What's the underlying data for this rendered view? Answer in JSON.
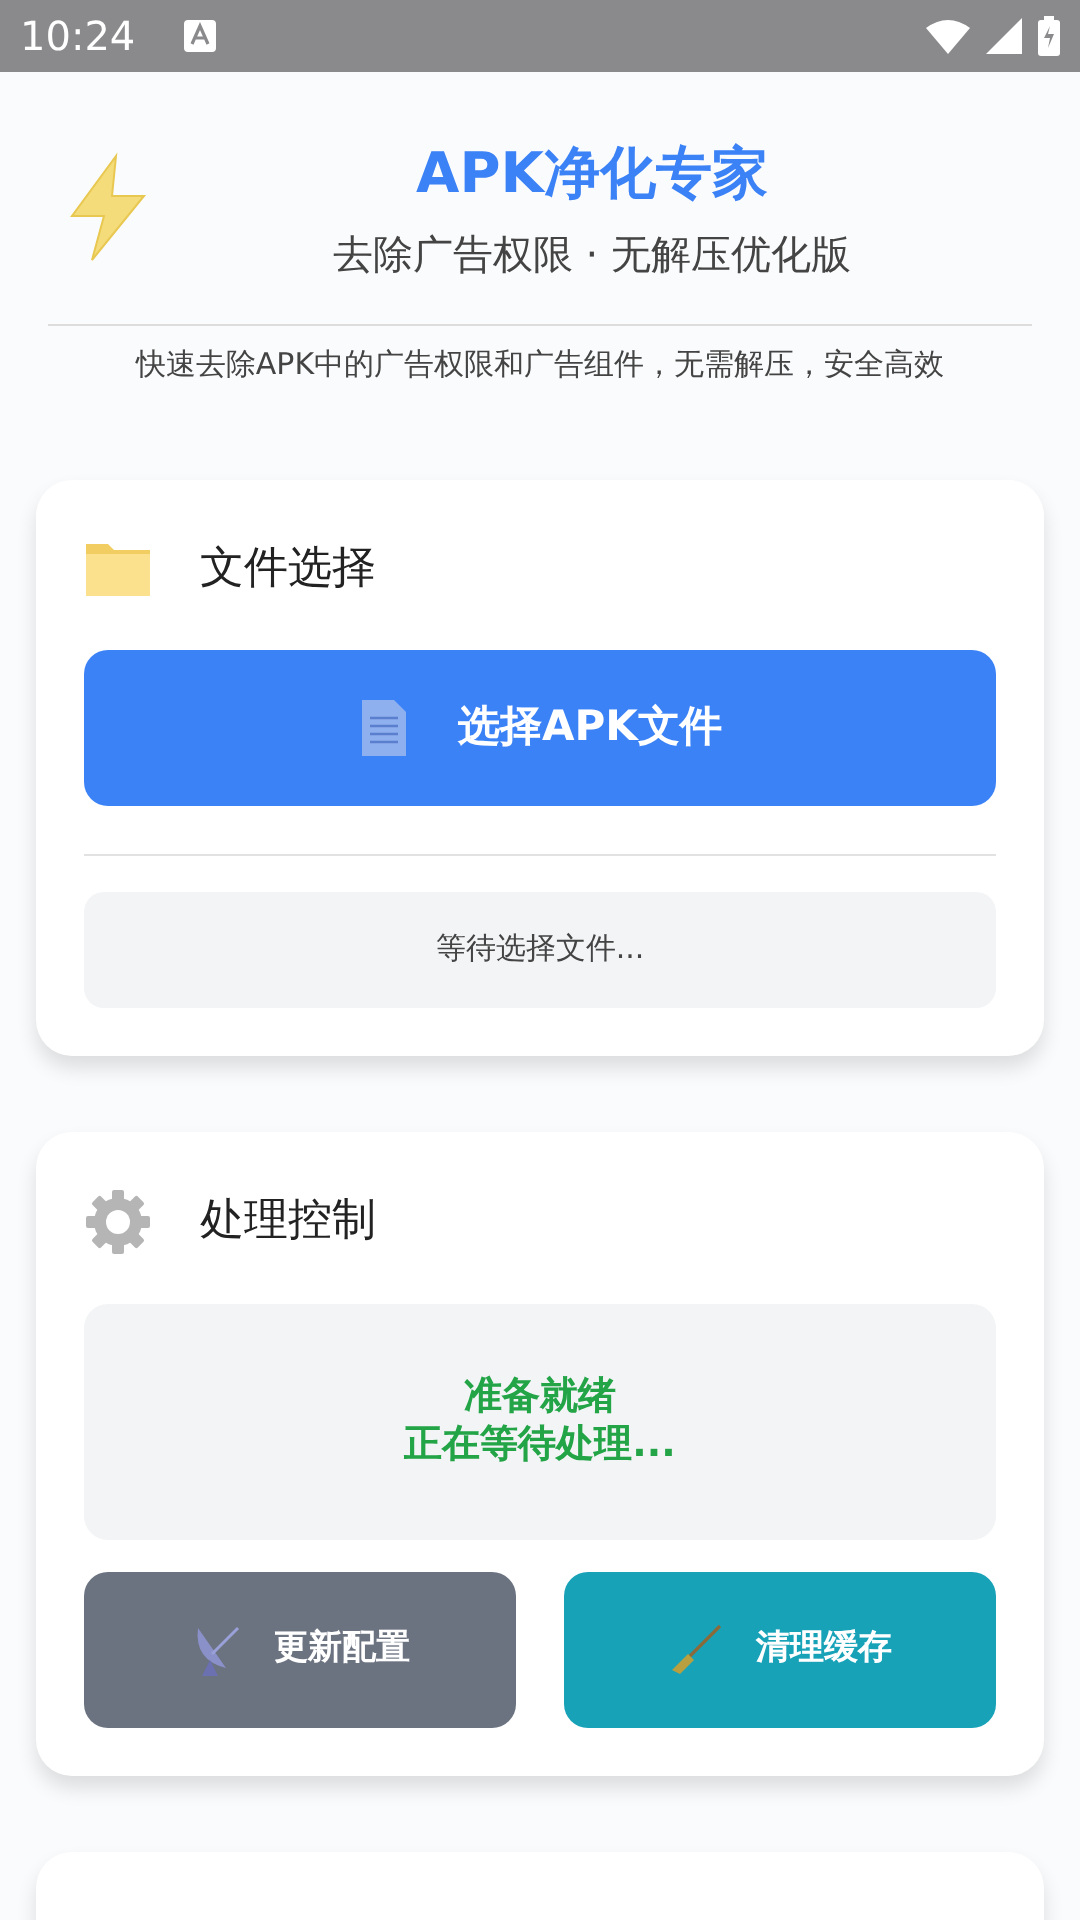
{
  "status_bar": {
    "time": "10:24"
  },
  "header": {
    "title": "APK净化专家",
    "subtitle": "去除广告权限 · 无解压优化版",
    "description": "快速去除APK中的广告权限和广告组件，无需解压，安全高效"
  },
  "file_card": {
    "title": "文件选择",
    "button": "选择APK文件",
    "status": "等待选择文件..."
  },
  "control_card": {
    "title": "处理控制",
    "status_lines": [
      "准备就绪",
      "正在等待处理..."
    ],
    "buttons": [
      {
        "kind": "config",
        "label": "更新配置"
      },
      {
        "kind": "clean",
        "label": "清理缓存"
      }
    ]
  }
}
